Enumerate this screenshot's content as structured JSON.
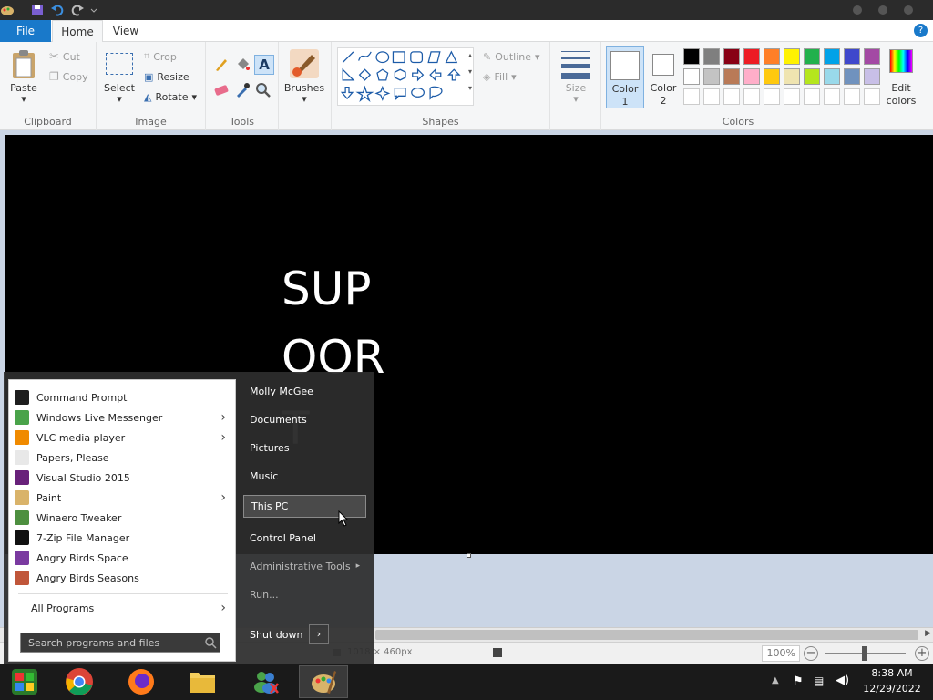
{
  "ribbon_tabs": {
    "file": "File",
    "home": "Home",
    "view": "View"
  },
  "clipboard": {
    "paste": "Paste",
    "cut": "Cut",
    "copy": "Copy",
    "group": "Clipboard"
  },
  "image": {
    "select": "Select",
    "crop": "Crop",
    "resize": "Resize",
    "rotate": "Rotate",
    "group": "Image"
  },
  "tools": {
    "group": "Tools"
  },
  "brushes": {
    "label": "Brushes"
  },
  "shapes": {
    "outline": "Outline",
    "fill": "Fill",
    "group": "Shapes"
  },
  "size": {
    "label": "Size"
  },
  "colors": {
    "color1_line1": "Color",
    "color1_line2": "1",
    "color2_line1": "Color",
    "color2_line2": "2",
    "edit_line1": "Edit",
    "edit_line2": "colors",
    "group": "Colors",
    "palette_row1": [
      "#000000",
      "#7f7f7f",
      "#880015",
      "#ed1c24",
      "#ff7f27",
      "#fff200",
      "#22b14c",
      "#00a2e8",
      "#3f48cc",
      "#a349a4"
    ],
    "palette_row2": [
      "#ffffff",
      "#c3c3c3",
      "#b97a57",
      "#ffaec9",
      "#ffc90e",
      "#efe4b0",
      "#b5e61d",
      "#99d9ea",
      "#7092be",
      "#c8bfe7"
    ]
  },
  "canvas_text": {
    "line1": "SUP",
    "line2": "OOR",
    "line3": "T"
  },
  "status": {
    "dimensions": "1018 × 460px",
    "zoom": "100%"
  },
  "start_menu": {
    "programs": [
      {
        "label": "Command Prompt",
        "arrow": "",
        "color": "#1e1e1e"
      },
      {
        "label": "Windows Live Messenger",
        "arrow": "›",
        "color": "#4aa34a"
      },
      {
        "label": "VLC media player",
        "arrow": "›",
        "color": "#f08a00"
      },
      {
        "label": "Papers, Please",
        "arrow": "",
        "color": "#e8e8e8"
      },
      {
        "label": "Visual Studio 2015",
        "arrow": "",
        "color": "#68217a"
      },
      {
        "label": "Paint",
        "arrow": "›",
        "color": "#d9b36a"
      },
      {
        "label": "Winaero Tweaker",
        "arrow": "",
        "color": "#4d8f3f"
      },
      {
        "label": "7-Zip File Manager",
        "arrow": "",
        "color": "#111111"
      },
      {
        "label": "Angry Birds Space",
        "arrow": "",
        "color": "#7a3aa0"
      },
      {
        "label": "Angry Birds Seasons",
        "arrow": "",
        "color": "#c0563a"
      }
    ],
    "all_programs": "All Programs",
    "search_placeholder": "Search programs and files",
    "right": {
      "user": "Molly McGee",
      "documents": "Documents",
      "pictures": "Pictures",
      "music": "Music",
      "this_pc": "This PC",
      "control_panel": "Control Panel",
      "admin_tools": "Administrative Tools",
      "run": "Run...",
      "shutdown": "Shut down"
    }
  },
  "clock": {
    "time": "8:38 AM",
    "date": "12/29/2022"
  }
}
